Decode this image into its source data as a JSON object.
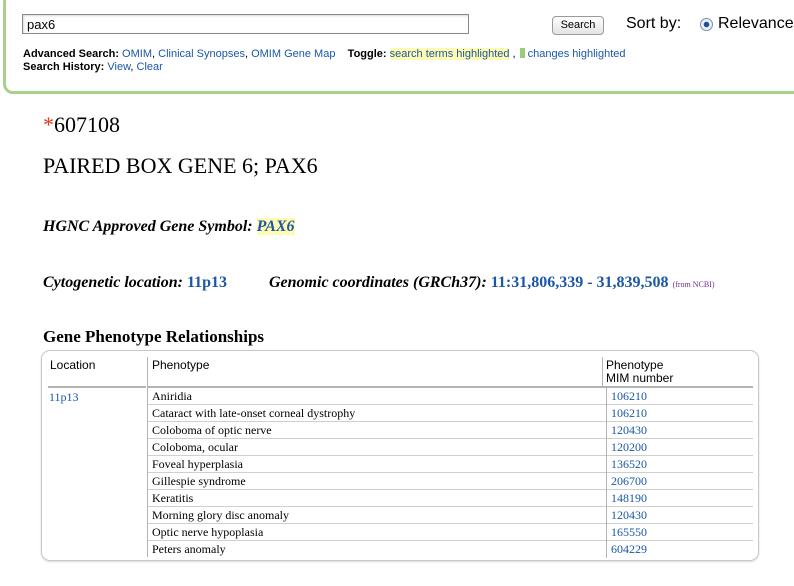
{
  "search": {
    "query": "pax6",
    "button_label": "Search",
    "sort_label": "Sort by:",
    "sort_option": "Relevance"
  },
  "advanced": {
    "label": "Advanced Search:",
    "links": [
      "OMIM",
      "Clinical Synopses",
      "OMIM Gene Map"
    ],
    "toggle_label": "Toggle:",
    "toggle_search_terms": "search terms highlighted",
    "toggle_changes": "changes highlighted"
  },
  "history": {
    "label": "Search History:",
    "view": "View",
    "clear": "Clear"
  },
  "entry": {
    "asterisk": "*",
    "mim_number": "607108",
    "title": "PAIRED BOX GENE 6; PAX6",
    "hgnc_label": "HGNC Approved Gene Symbol:",
    "hgnc_symbol": "PAX6",
    "cyto_label": "Cytogenetic location:",
    "cyto_value": "11p13",
    "genomic_label": "Genomic coordinates (GRCh37):",
    "genomic_value": "11:31,806,339 - 31,839,508",
    "from_ncbi": "(from NCBI)"
  },
  "phenotype_table": {
    "section_title": "Gene Phenotype Relationships",
    "headers": {
      "location": "Location",
      "phenotype": "Phenotype",
      "mim_line1": "Phenotype",
      "mim_line2": "MIM number"
    },
    "location": "11p13",
    "rows": [
      {
        "phenotype": "Aniridia",
        "mim": "106210"
      },
      {
        "phenotype": "Cataract with late-onset corneal dystrophy",
        "mim": "106210"
      },
      {
        "phenotype": "Coloboma of optic nerve",
        "mim": "120430"
      },
      {
        "phenotype": "Coloboma, ocular",
        "mim": "120200"
      },
      {
        "phenotype": "Foveal hyperplasia",
        "mim": "136520"
      },
      {
        "phenotype": "Gillespie syndrome",
        "mim": "206700"
      },
      {
        "phenotype": "Keratitis",
        "mim": "148190"
      },
      {
        "phenotype": "Morning glory disc anomaly",
        "mim": "120430"
      },
      {
        "phenotype": "Optic nerve hypoplasia",
        "mim": "165550"
      },
      {
        "phenotype": "Peters anomaly",
        "mim": "604229"
      }
    ]
  }
}
